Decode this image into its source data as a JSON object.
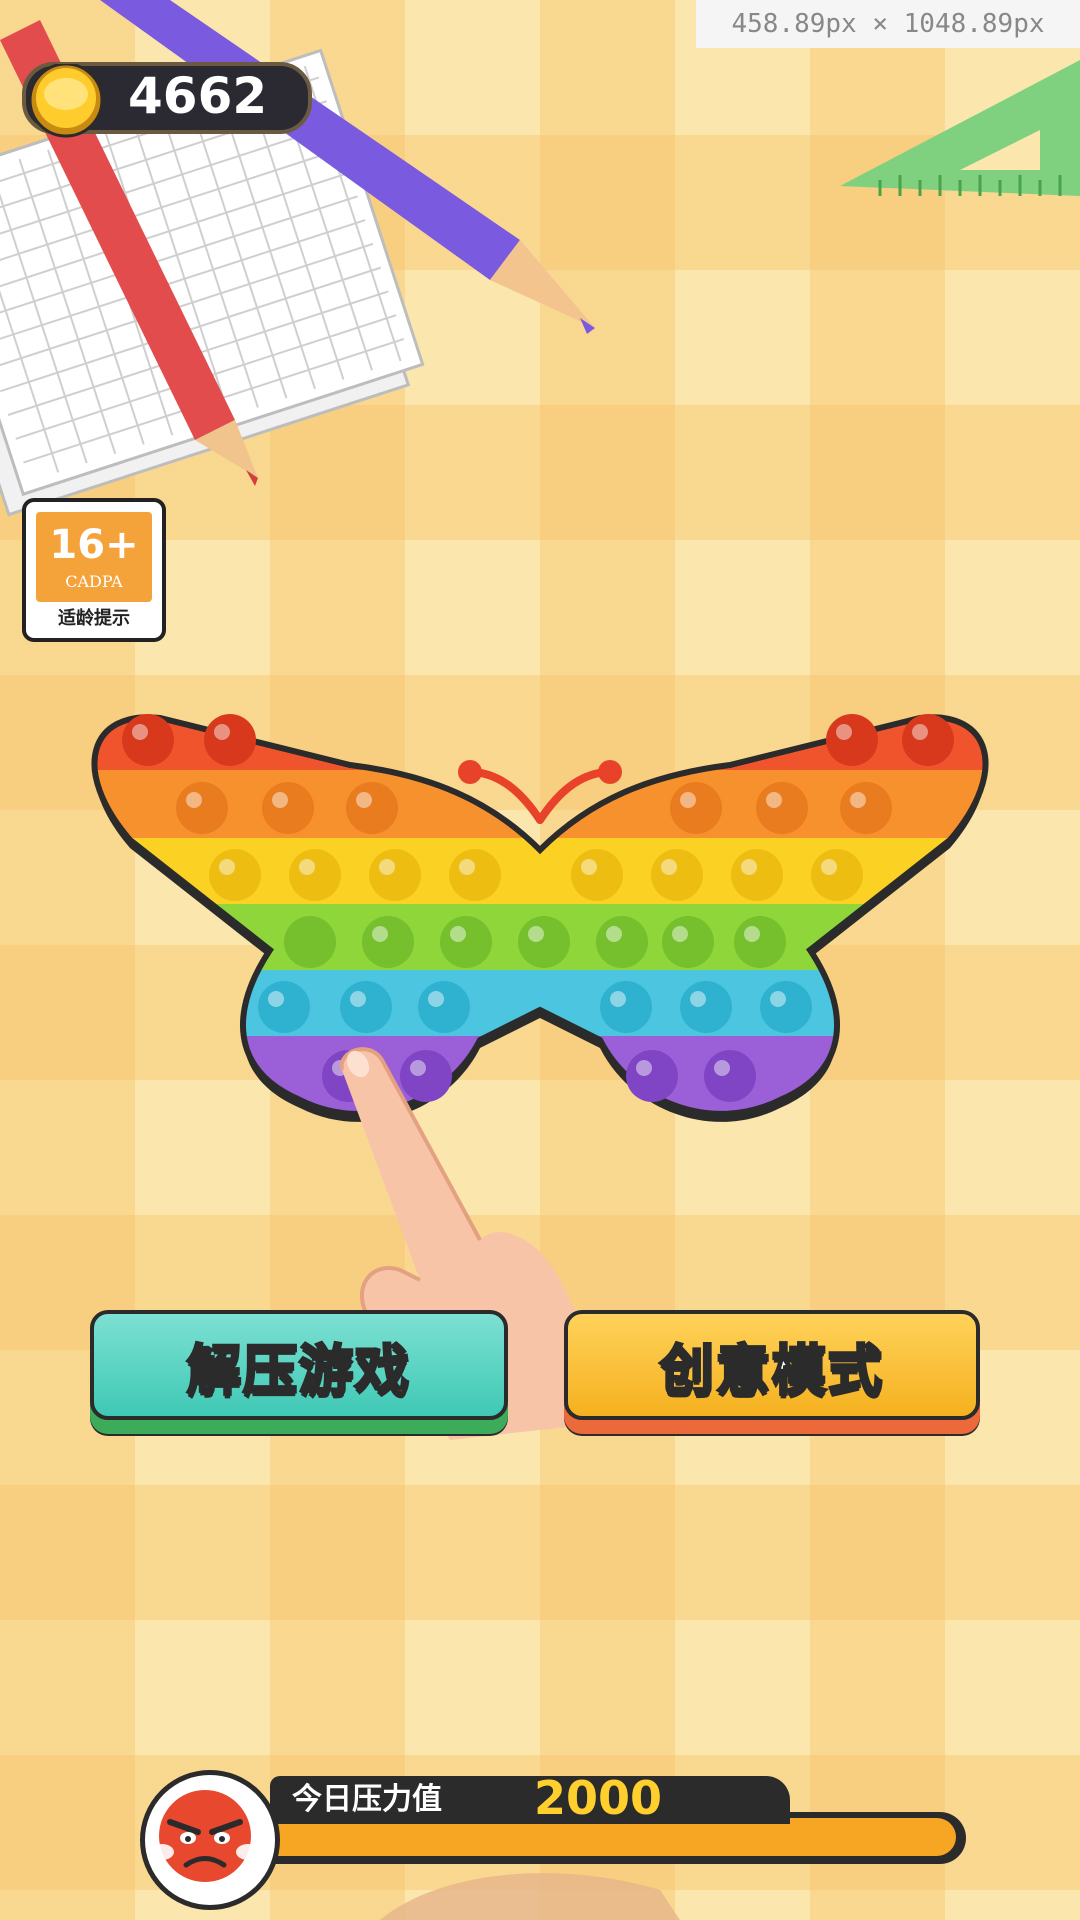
{
  "devtools": {
    "size_readout": "458.89px × 1048.89px"
  },
  "header": {
    "coins": "4662"
  },
  "age_rating": {
    "age": "16+",
    "org": "CADPA",
    "label": "适龄提示"
  },
  "main": {
    "buttons": {
      "relax": "解压游戏",
      "creative": "创意模式"
    }
  },
  "stress": {
    "label": "今日压力值",
    "value": "2000",
    "fill": 1.0
  },
  "icons": [
    "coin-icon",
    "age-badge-icon",
    "butterfly-popit",
    "pointing-hand",
    "angry-face-icon",
    "pencil",
    "ruler",
    "grid-paper"
  ],
  "colors": {
    "teal_button": "#3fc9b5",
    "orange_button": "#f5b11f",
    "bar": "#f6a623",
    "dark": "#2b2b2b"
  }
}
